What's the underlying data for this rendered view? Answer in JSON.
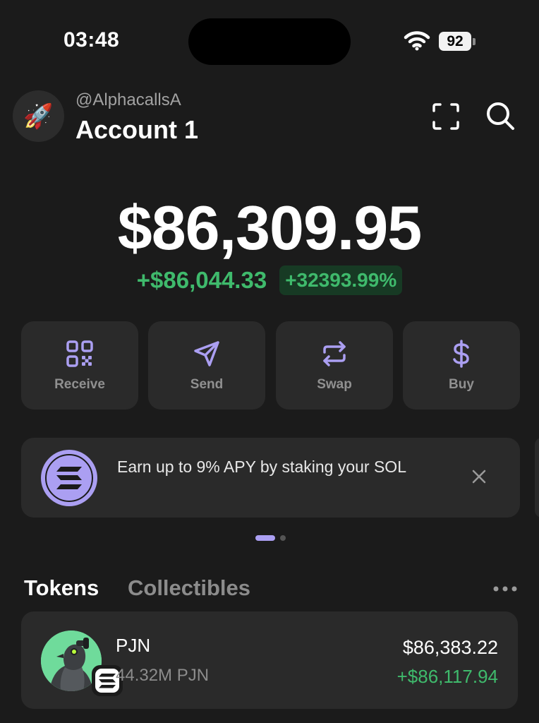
{
  "status_bar": {
    "time": "03:48",
    "battery": "92"
  },
  "header": {
    "avatar_emoji": "🚀",
    "handle": "@AlphacallsA",
    "account_name": "Account 1",
    "icons": [
      "scan-icon",
      "search-icon"
    ]
  },
  "balance": {
    "total": "$86,309.95",
    "change_amount": "+$86,044.33",
    "change_percent": "+32393.99%"
  },
  "actions": [
    {
      "label": "Receive",
      "icon": "qr-code-icon"
    },
    {
      "label": "Send",
      "icon": "send-icon"
    },
    {
      "label": "Swap",
      "icon": "swap-icon"
    },
    {
      "label": "Buy",
      "icon": "dollar-icon"
    }
  ],
  "banner": {
    "text": "Earn up to 9% APY by staking your SOL",
    "icon": "solana-icon"
  },
  "carousel": {
    "page": 1,
    "pages": 2
  },
  "tabs": {
    "active": "Tokens",
    "inactive": "Collectibles"
  },
  "tokens": [
    {
      "name": "PJN",
      "amount": "44.32M PJN",
      "value": "$86,383.22",
      "change": "+$86,117.94"
    }
  ],
  "colors": {
    "background": "#1b1b1b",
    "card": "#2a2a2a",
    "accent": "#ab9ff2",
    "positive": "#3fba6c"
  }
}
